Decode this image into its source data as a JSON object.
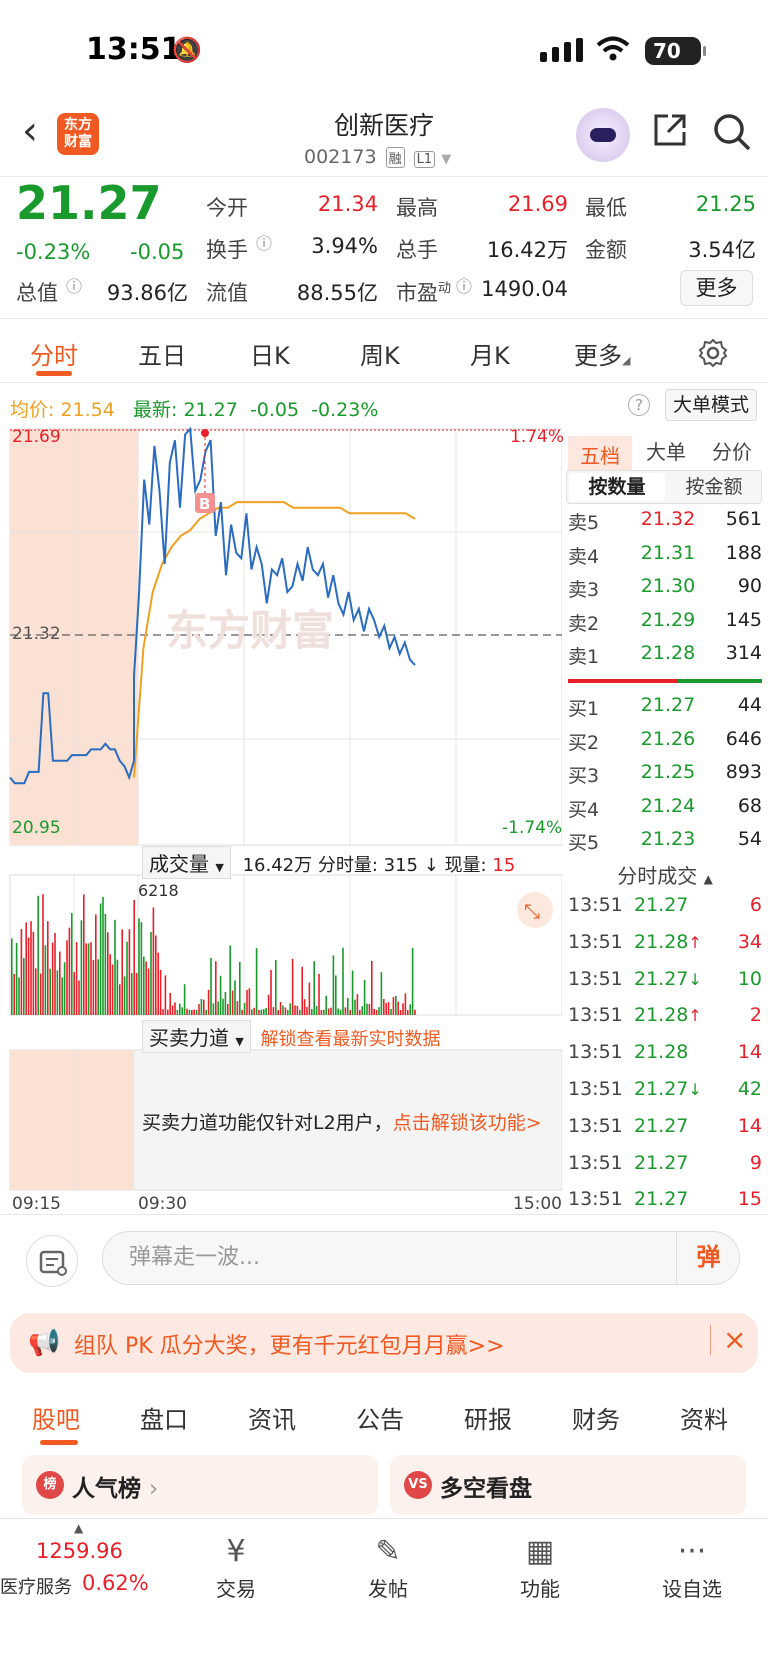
{
  "status": {
    "time": "13:51",
    "battery": "70"
  },
  "header": {
    "logo": "东方财富",
    "title": "创新医疗",
    "code": "002173",
    "tag1": "融",
    "tag2": "L1"
  },
  "quote": {
    "price": "21.27",
    "pct": "-0.23%",
    "chg": "-0.05",
    "open_label": "今开",
    "open": "21.34",
    "high_label": "最高",
    "high": "21.69",
    "low_label": "最低",
    "low": "21.25",
    "turnover_label": "换手",
    "turnover": "3.94%",
    "volume_label": "总手",
    "volume": "16.42万",
    "amount_label": "金额",
    "amount": "3.54亿",
    "mktcap_label": "总值",
    "mktcap": "93.86亿",
    "float_label": "流值",
    "float": "88.55亿",
    "pe_label": "市盈",
    "pe_sup": "动",
    "pe": "1490.04",
    "more": "更多"
  },
  "tabs": [
    "分时",
    "五日",
    "日K",
    "周K",
    "月K",
    "更多"
  ],
  "chart_info": {
    "avg_label": "均价:",
    "avg": "21.54",
    "latest_label": "最新:",
    "latest": "21.27",
    "chg": "-0.05",
    "pct": "-0.23%",
    "big_order": "大单模式"
  },
  "chart_labels": {
    "top_price": "21.69",
    "top_pct": "1.74%",
    "mid_price": "21.32",
    "bottom_price": "20.95",
    "bottom_pct": "-1.74%",
    "marker": "B",
    "watermark": "东方财富",
    "vol_peak": "6218"
  },
  "vol_info": {
    "selector": "成交量",
    "total": "16.42万",
    "minute_label": "分时量:",
    "minute": "315",
    "arrow": "↓",
    "now_label": "现量:",
    "now": "15"
  },
  "force": {
    "selector": "买卖力道",
    "unlock": "解锁查看最新实时数据",
    "msg": "买卖力道功能仅针对L2用户，",
    "msg_link": "点击解锁该功能>"
  },
  "time_axis": [
    "09:15",
    "09:30",
    "15:00"
  ],
  "side": {
    "tabs": [
      "五档",
      "大单",
      "分价"
    ],
    "seg": [
      "按数量",
      "按金额"
    ],
    "sells": [
      {
        "k": "卖5",
        "p": "21.32",
        "q": "561",
        "c": "red"
      },
      {
        "k": "卖4",
        "p": "21.31",
        "q": "188",
        "c": "green"
      },
      {
        "k": "卖3",
        "p": "21.30",
        "q": "90",
        "c": "green"
      },
      {
        "k": "卖2",
        "p": "21.29",
        "q": "145",
        "c": "green"
      },
      {
        "k": "卖1",
        "p": "21.28",
        "q": "314",
        "c": "green"
      }
    ],
    "buys": [
      {
        "k": "买1",
        "p": "21.27",
        "q": "44",
        "c": "green"
      },
      {
        "k": "买2",
        "p": "21.26",
        "q": "646",
        "c": "green"
      },
      {
        "k": "买3",
        "p": "21.25",
        "q": "893",
        "c": "green"
      },
      {
        "k": "买4",
        "p": "21.24",
        "q": "68",
        "c": "green"
      },
      {
        "k": "买5",
        "p": "21.23",
        "q": "54",
        "c": "green"
      }
    ],
    "trade_header": "分时成交",
    "trades": [
      {
        "t": "13:51",
        "p": "21.27",
        "d": "",
        "q": "6",
        "qc": "red"
      },
      {
        "t": "13:51",
        "p": "21.28",
        "d": "↑",
        "q": "34",
        "qc": "red"
      },
      {
        "t": "13:51",
        "p": "21.27",
        "d": "↓",
        "q": "10",
        "qc": "green"
      },
      {
        "t": "13:51",
        "p": "21.28",
        "d": "↑",
        "q": "2",
        "qc": "red"
      },
      {
        "t": "13:51",
        "p": "21.28",
        "d": "",
        "q": "14",
        "qc": "red"
      },
      {
        "t": "13:51",
        "p": "21.27",
        "d": "↓",
        "q": "42",
        "qc": "green"
      },
      {
        "t": "13:51",
        "p": "21.27",
        "d": "",
        "q": "14",
        "qc": "red"
      },
      {
        "t": "13:51",
        "p": "21.27",
        "d": "",
        "q": "9",
        "qc": "red"
      },
      {
        "t": "13:51",
        "p": "21.27",
        "d": "",
        "q": "15",
        "qc": "red"
      }
    ]
  },
  "danmu": {
    "placeholder": "弹幕走一波...",
    "btn": "弹"
  },
  "promo": {
    "text": "组队 PK 瓜分大奖，更有千元红包月月赢>>",
    "close": "×"
  },
  "bottom_tabs": [
    "股吧",
    "盘口",
    "资讯",
    "公告",
    "研报",
    "财务",
    "资料"
  ],
  "cards": [
    {
      "icon": "榜",
      "label": "人气榜"
    },
    {
      "icon": "VS",
      "label": "多空看盘"
    }
  ],
  "bottom": {
    "index_value": "1259.96",
    "index_name": "医疗服务",
    "index_pct": "0.62%",
    "items": [
      {
        "icon": "¥",
        "label": "交易"
      },
      {
        "icon": "✎",
        "label": "发帖"
      },
      {
        "icon": "▦",
        "label": "功能"
      },
      {
        "icon": "···",
        "label": "设自选"
      }
    ]
  },
  "colors": {
    "up": "#e8202a",
    "down": "#1a9a2c",
    "accent": "#f05a22",
    "avg": "#f0a020",
    "price_line": "#2a6cc0"
  },
  "chart_data": {
    "type": "line",
    "price_series": [
      21.07,
      21.06,
      21.06,
      21.06,
      21.08,
      21.08,
      21.08,
      21.22,
      21.22,
      21.1,
      21.1,
      21.1,
      21.1,
      21.11,
      21.11,
      21.11,
      21.11,
      21.12,
      21.12,
      21.12,
      21.13,
      21.12,
      21.12,
      21.1,
      21.09,
      21.07,
      21.1,
      21.25,
      21.4,
      21.6,
      21.52,
      21.66,
      21.58,
      21.45,
      21.63,
      21.67,
      21.55,
      21.68,
      21.69,
      21.58,
      21.6,
      21.65,
      21.67,
      21.5,
      21.56,
      21.43,
      21.52,
      21.47,
      21.46,
      21.54,
      21.44,
      21.48,
      21.45,
      21.38,
      21.44,
      21.43,
      21.46,
      21.4,
      21.41,
      21.45,
      21.42,
      21.48,
      21.44,
      21.43,
      21.45,
      21.39,
      21.43,
      21.38,
      21.36,
      21.4,
      21.35,
      21.37,
      21.33,
      21.37,
      21.35,
      21.32,
      21.34,
      21.3,
      21.32,
      21.29,
      21.31,
      21.28,
      21.27
    ],
    "avg_series": [
      21.07,
      21.3,
      21.4,
      21.45,
      21.48,
      21.5,
      21.51,
      21.53,
      21.54,
      21.55,
      21.55,
      21.56,
      21.56,
      21.56,
      21.56,
      21.56,
      21.56,
      21.55,
      21.55,
      21.55,
      21.55,
      21.55,
      21.55,
      21.54,
      21.54,
      21.54,
      21.54,
      21.54,
      21.54,
      21.54,
      21.53
    ],
    "ylim": [
      20.95,
      21.69
    ],
    "prev_close": 21.32,
    "x_labels": [
      "09:15",
      "09:30",
      "15:00"
    ]
  }
}
